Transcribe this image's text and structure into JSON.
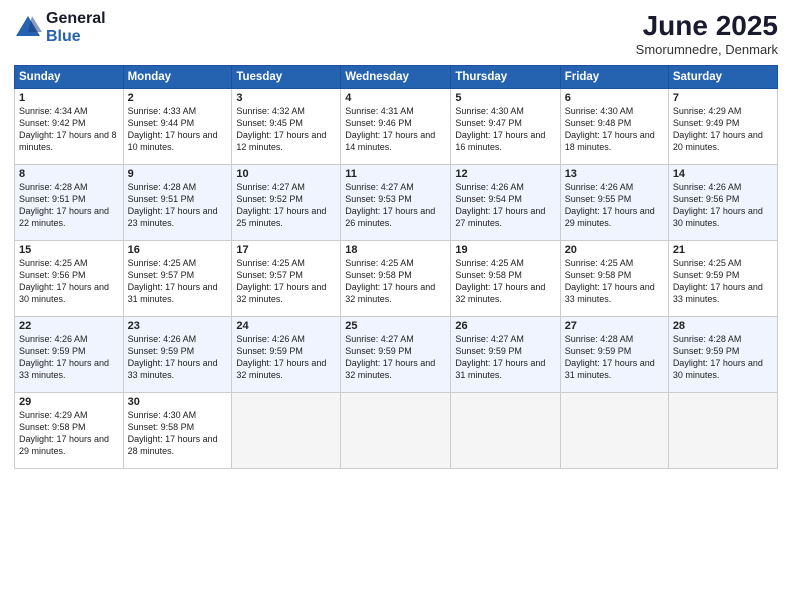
{
  "logo": {
    "general": "General",
    "blue": "Blue"
  },
  "title": "June 2025",
  "subtitle": "Smorumnedre, Denmark",
  "weekdays": [
    "Sunday",
    "Monday",
    "Tuesday",
    "Wednesday",
    "Thursday",
    "Friday",
    "Saturday"
  ],
  "weeks": [
    [
      {
        "day": "1",
        "sunrise": "4:34 AM",
        "sunset": "9:42 PM",
        "daylight": "17 hours and 8 minutes."
      },
      {
        "day": "2",
        "sunrise": "4:33 AM",
        "sunset": "9:44 PM",
        "daylight": "17 hours and 10 minutes."
      },
      {
        "day": "3",
        "sunrise": "4:32 AM",
        "sunset": "9:45 PM",
        "daylight": "17 hours and 12 minutes."
      },
      {
        "day": "4",
        "sunrise": "4:31 AM",
        "sunset": "9:46 PM",
        "daylight": "17 hours and 14 minutes."
      },
      {
        "day": "5",
        "sunrise": "4:30 AM",
        "sunset": "9:47 PM",
        "daylight": "17 hours and 16 minutes."
      },
      {
        "day": "6",
        "sunrise": "4:30 AM",
        "sunset": "9:48 PM",
        "daylight": "17 hours and 18 minutes."
      },
      {
        "day": "7",
        "sunrise": "4:29 AM",
        "sunset": "9:49 PM",
        "daylight": "17 hours and 20 minutes."
      }
    ],
    [
      {
        "day": "8",
        "sunrise": "4:28 AM",
        "sunset": "9:51 PM",
        "daylight": "17 hours and 22 minutes."
      },
      {
        "day": "9",
        "sunrise": "4:28 AM",
        "sunset": "9:51 PM",
        "daylight": "17 hours and 23 minutes."
      },
      {
        "day": "10",
        "sunrise": "4:27 AM",
        "sunset": "9:52 PM",
        "daylight": "17 hours and 25 minutes."
      },
      {
        "day": "11",
        "sunrise": "4:27 AM",
        "sunset": "9:53 PM",
        "daylight": "17 hours and 26 minutes."
      },
      {
        "day": "12",
        "sunrise": "4:26 AM",
        "sunset": "9:54 PM",
        "daylight": "17 hours and 27 minutes."
      },
      {
        "day": "13",
        "sunrise": "4:26 AM",
        "sunset": "9:55 PM",
        "daylight": "17 hours and 29 minutes."
      },
      {
        "day": "14",
        "sunrise": "4:26 AM",
        "sunset": "9:56 PM",
        "daylight": "17 hours and 30 minutes."
      }
    ],
    [
      {
        "day": "15",
        "sunrise": "4:25 AM",
        "sunset": "9:56 PM",
        "daylight": "17 hours and 30 minutes."
      },
      {
        "day": "16",
        "sunrise": "4:25 AM",
        "sunset": "9:57 PM",
        "daylight": "17 hours and 31 minutes."
      },
      {
        "day": "17",
        "sunrise": "4:25 AM",
        "sunset": "9:57 PM",
        "daylight": "17 hours and 32 minutes."
      },
      {
        "day": "18",
        "sunrise": "4:25 AM",
        "sunset": "9:58 PM",
        "daylight": "17 hours and 32 minutes."
      },
      {
        "day": "19",
        "sunrise": "4:25 AM",
        "sunset": "9:58 PM",
        "daylight": "17 hours and 32 minutes."
      },
      {
        "day": "20",
        "sunrise": "4:25 AM",
        "sunset": "9:58 PM",
        "daylight": "17 hours and 33 minutes."
      },
      {
        "day": "21",
        "sunrise": "4:25 AM",
        "sunset": "9:59 PM",
        "daylight": "17 hours and 33 minutes."
      }
    ],
    [
      {
        "day": "22",
        "sunrise": "4:26 AM",
        "sunset": "9:59 PM",
        "daylight": "17 hours and 33 minutes."
      },
      {
        "day": "23",
        "sunrise": "4:26 AM",
        "sunset": "9:59 PM",
        "daylight": "17 hours and 33 minutes."
      },
      {
        "day": "24",
        "sunrise": "4:26 AM",
        "sunset": "9:59 PM",
        "daylight": "17 hours and 32 minutes."
      },
      {
        "day": "25",
        "sunrise": "4:27 AM",
        "sunset": "9:59 PM",
        "daylight": "17 hours and 32 minutes."
      },
      {
        "day": "26",
        "sunrise": "4:27 AM",
        "sunset": "9:59 PM",
        "daylight": "17 hours and 31 minutes."
      },
      {
        "day": "27",
        "sunrise": "4:28 AM",
        "sunset": "9:59 PM",
        "daylight": "17 hours and 31 minutes."
      },
      {
        "day": "28",
        "sunrise": "4:28 AM",
        "sunset": "9:59 PM",
        "daylight": "17 hours and 30 minutes."
      }
    ],
    [
      {
        "day": "29",
        "sunrise": "4:29 AM",
        "sunset": "9:58 PM",
        "daylight": "17 hours and 29 minutes."
      },
      {
        "day": "30",
        "sunrise": "4:30 AM",
        "sunset": "9:58 PM",
        "daylight": "17 hours and 28 minutes."
      },
      null,
      null,
      null,
      null,
      null
    ]
  ],
  "labels": {
    "sunrise": "Sunrise:",
    "sunset": "Sunset:",
    "daylight": "Daylight:"
  }
}
